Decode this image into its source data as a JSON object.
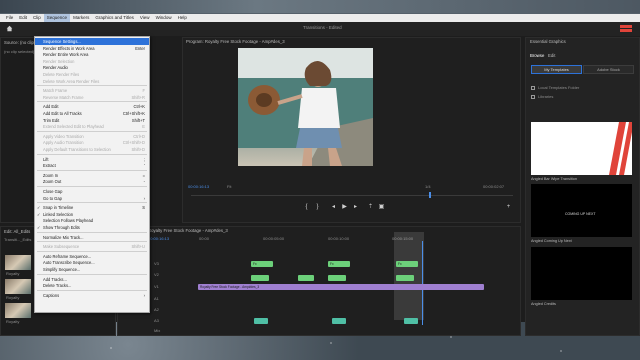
{
  "menubar": {
    "items": [
      "File",
      "Edit",
      "Clip",
      "Sequence",
      "Markers",
      "Graphics and Titles",
      "View",
      "Window",
      "Help"
    ],
    "active_index": 3
  },
  "app_title": "Transitions - Edited",
  "left_panel": {
    "source_tab": "Source: (no clips)",
    "no_selection": "(no clip selected)",
    "project_tab": "Edit: All_Edits",
    "project_sub": "Transiti..._Edits",
    "items": [
      "Royalty",
      "Royalty",
      "Royalty"
    ]
  },
  "sequence_menu": {
    "items": [
      {
        "label": "Sequence Settings...",
        "shortcut": "",
        "state": "highlighted",
        "check": false
      },
      {
        "label": "Render Effects in Work Area",
        "shortcut": "Enter",
        "state": "enabled",
        "check": false
      },
      {
        "label": "Render Entire Work Area",
        "shortcut": "",
        "state": "enabled",
        "check": false
      },
      {
        "label": "Render Selection",
        "shortcut": "",
        "state": "disabled",
        "check": false
      },
      {
        "label": "Render Audio",
        "shortcut": "",
        "state": "enabled",
        "check": false
      },
      {
        "label": "Delete Render Files",
        "shortcut": "",
        "state": "disabled",
        "check": false
      },
      {
        "label": "Delete Work Area Render Files",
        "shortcut": "",
        "state": "disabled",
        "check": false
      },
      {
        "sep": true
      },
      {
        "label": "Match Frame",
        "shortcut": "F",
        "state": "disabled",
        "check": false
      },
      {
        "label": "Reverse Match Frame",
        "shortcut": "Shift+R",
        "state": "disabled",
        "check": false
      },
      {
        "sep": true
      },
      {
        "label": "Add Edit",
        "shortcut": "Ctrl+K",
        "state": "enabled",
        "check": false
      },
      {
        "label": "Add Edit to All Tracks",
        "shortcut": "Ctrl+Shift+K",
        "state": "enabled",
        "check": false
      },
      {
        "label": "Trim Edit",
        "shortcut": "Shift+T",
        "state": "enabled",
        "check": false
      },
      {
        "label": "Extend Selected Edit to Playhead",
        "shortcut": "E",
        "state": "disabled",
        "check": false
      },
      {
        "sep": true
      },
      {
        "label": "Apply Video Transition",
        "shortcut": "Ctrl+D",
        "state": "disabled",
        "check": false
      },
      {
        "label": "Apply Audio Transition",
        "shortcut": "Ctrl+Shift+D",
        "state": "disabled",
        "check": false
      },
      {
        "label": "Apply Default Transitions to Selection",
        "shortcut": "Shift+D",
        "state": "disabled",
        "check": false
      },
      {
        "sep": true
      },
      {
        "label": "Lift",
        "shortcut": ";",
        "state": "enabled",
        "check": false
      },
      {
        "label": "Extract",
        "shortcut": "'",
        "state": "enabled",
        "check": false
      },
      {
        "sep": true
      },
      {
        "label": "Zoom In",
        "shortcut": "=",
        "state": "enabled",
        "check": false
      },
      {
        "label": "Zoom Out",
        "shortcut": "-",
        "state": "enabled",
        "check": false
      },
      {
        "sep": true
      },
      {
        "label": "Close Gap",
        "shortcut": "",
        "state": "enabled",
        "check": false
      },
      {
        "label": "Go to Gap",
        "shortcut": "›",
        "state": "enabled",
        "check": false
      },
      {
        "sep": true
      },
      {
        "label": "Snap in Timeline",
        "shortcut": "S",
        "state": "enabled",
        "check": true
      },
      {
        "label": "Linked Selection",
        "shortcut": "",
        "state": "enabled",
        "check": true
      },
      {
        "label": "Selection Follows Playhead",
        "shortcut": "",
        "state": "enabled",
        "check": false
      },
      {
        "label": "Show Through Edits",
        "shortcut": "",
        "state": "enabled",
        "check": true
      },
      {
        "sep": true
      },
      {
        "label": "Normalize Mix Track...",
        "shortcut": "",
        "state": "enabled",
        "check": false
      },
      {
        "sep": true
      },
      {
        "label": "Make Subsequence",
        "shortcut": "Shift+U",
        "state": "disabled",
        "check": false
      },
      {
        "sep": true
      },
      {
        "label": "Auto Reframe Sequence...",
        "shortcut": "",
        "state": "enabled",
        "check": false
      },
      {
        "label": "Auto Transcribe Sequence...",
        "shortcut": "",
        "state": "enabled",
        "check": false
      },
      {
        "label": "Simplify Sequence...",
        "shortcut": "",
        "state": "enabled",
        "check": false
      },
      {
        "sep": true
      },
      {
        "label": "Add Tracks...",
        "shortcut": "",
        "state": "enabled",
        "check": false
      },
      {
        "label": "Delete Tracks...",
        "shortcut": "",
        "state": "enabled",
        "check": false
      },
      {
        "sep": true
      },
      {
        "label": "Captions",
        "shortcut": "›",
        "state": "enabled",
        "check": false
      }
    ]
  },
  "program": {
    "tab": "Program: Royalty Free Stock Footage - Amp#des_3",
    "timecode_in": "00:00:16:13",
    "fit": "Fit",
    "quality": "1/4",
    "timecode_out": "00:00:02:07"
  },
  "essential_graphics": {
    "tab": "Essential Graphics",
    "subtabs": [
      "Browse",
      "Edit"
    ],
    "buttons": [
      "My Templates",
      "Adobe Stock"
    ],
    "checks": [
      "Local Templates Folder",
      "Libraries"
    ],
    "templates": [
      "Angled Bar Wipe Transition",
      "Angled Coming Up Next",
      "Angled Credits"
    ],
    "thumb_text": "COMING UP NEXT"
  },
  "timeline": {
    "tab": "Royalty Free Stock Footage - Amp#des_3",
    "timecode": "00:00:16:13",
    "ruler": [
      "00:00",
      "00:00:05:00",
      "00:00:10:00",
      "00:00:15:00"
    ],
    "fx_label": "Fx",
    "audio_clip_label": "Royalty Free Stock Footage - Amp#des_3",
    "tracks": [
      "V3",
      "V2",
      "V1",
      "A1",
      "A2",
      "A3",
      "Mix"
    ]
  },
  "colors": {
    "accent_blue": "#2d72d9",
    "video_clip": "#6cd07a",
    "audio_clip": "#9f7fd0",
    "timecode_blue": "#4b8ee8",
    "logo_red": "#e0443a"
  }
}
